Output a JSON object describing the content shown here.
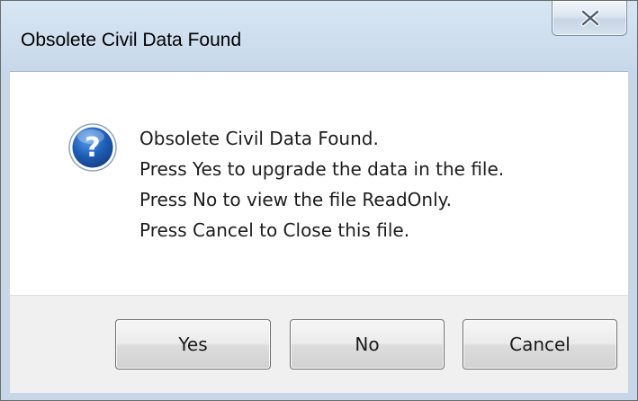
{
  "dialog": {
    "title": "Obsolete Civil Data Found",
    "close_icon": "close-x-icon",
    "message_icon": "question-icon",
    "message_lines": [
      "Obsolete Civil Data Found.",
      "Press Yes to upgrade the data in the file.",
      "Press No to view the file ReadOnly.",
      "Press Cancel to Close this file."
    ],
    "buttons": {
      "yes_label": "Yes",
      "no_label": "No",
      "cancel_label": "Cancel"
    }
  },
  "colors": {
    "frame": "#c7d7e8",
    "icon_blue": "#1f5fb8",
    "footer": "#f0f0f0"
  }
}
